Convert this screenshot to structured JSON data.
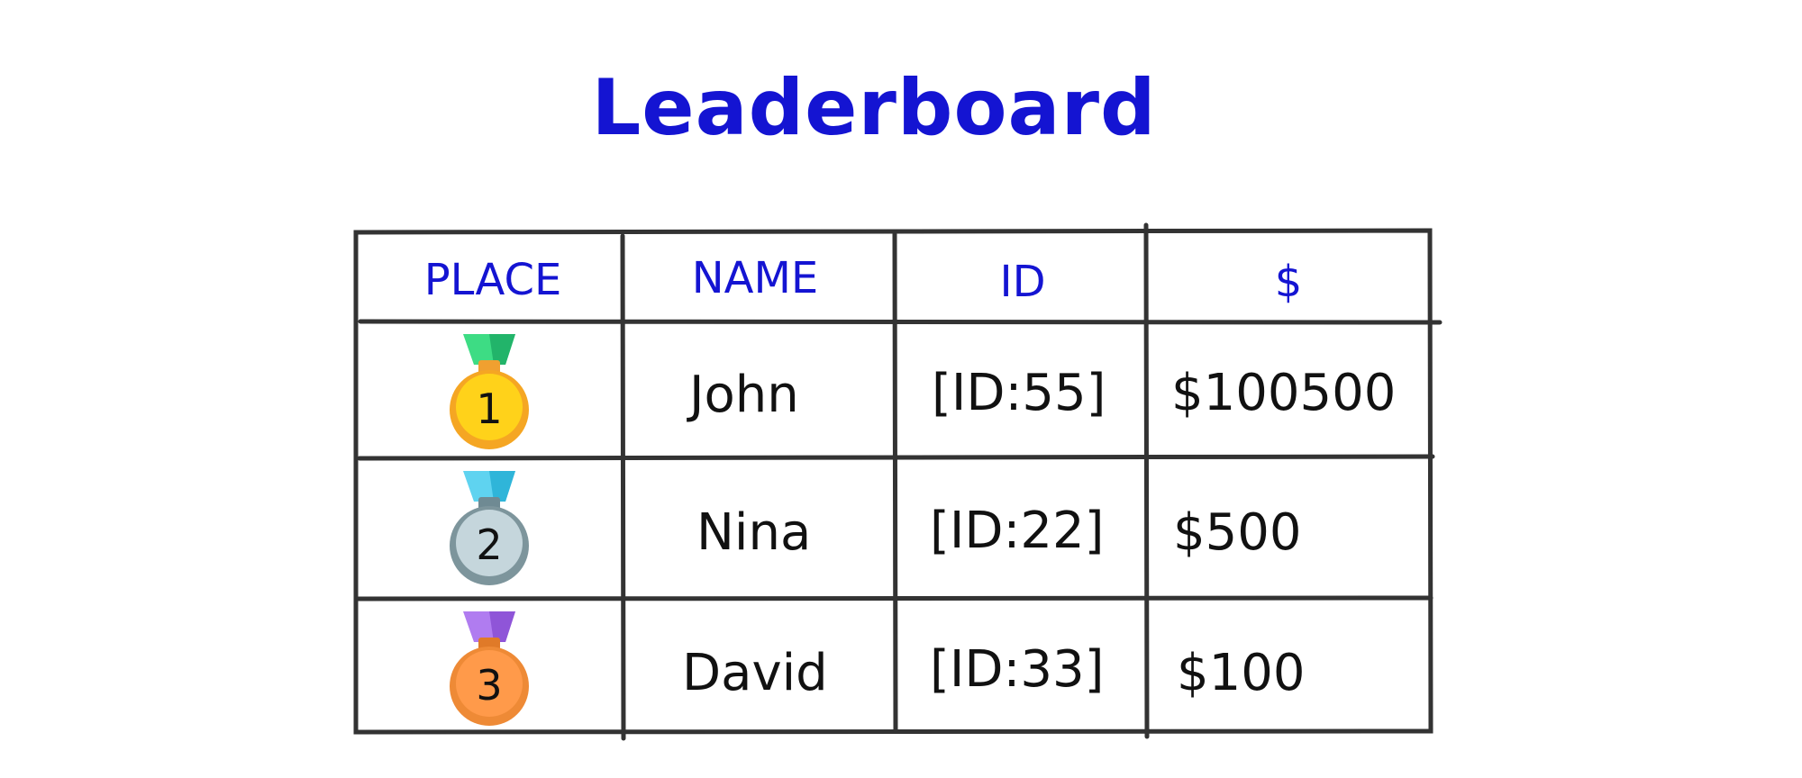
{
  "title": "Leaderboard",
  "columns": [
    "PLACE",
    "NAME",
    "ID",
    "$"
  ],
  "rows": [
    {
      "place": "1",
      "medal": "gold-medal-icon",
      "name": "John",
      "id": "[ID:55]",
      "amount": "$100500"
    },
    {
      "place": "2",
      "medal": "silver-medal-icon",
      "name": "Nina",
      "id": "[ID:22]",
      "amount": "$500"
    },
    {
      "place": "3",
      "medal": "bronze-medal-icon",
      "name": "David",
      "id": "[ID:33]",
      "amount": "$100"
    }
  ],
  "colors": {
    "accent": "#1414d2",
    "gold": "#ffd21a",
    "gold_ribbon": "#3ddc84",
    "silver": "#c5d6dc",
    "silver_ribbon": "#5fd3f0",
    "bronze": "#ff9a4a",
    "bronze_ribbon": "#b07cf0"
  }
}
